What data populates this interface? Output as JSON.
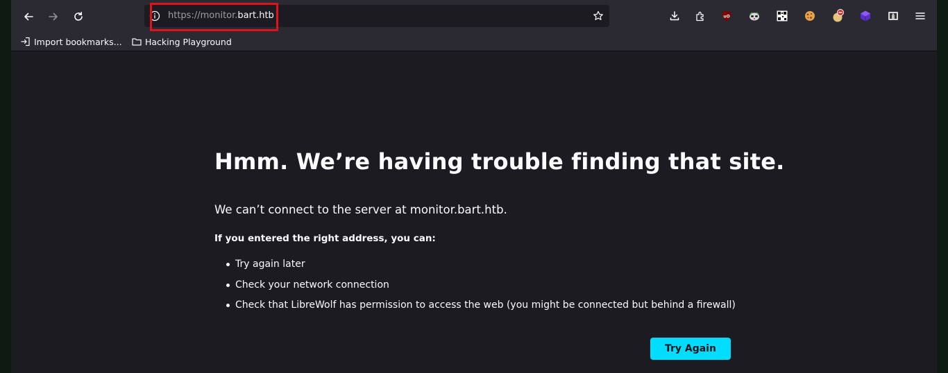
{
  "browser": {
    "url": {
      "scheme_prefix": "https://monitor.",
      "domain": "bart.htb"
    },
    "toolbar_icons": [
      "downloads-icon",
      "extensions-icon",
      "ublock-origin-icon",
      "privacy-badger-icon",
      "qr-code-icon",
      "cookie-autodelete-icon",
      "stop-sign-extension-icon",
      "cube-extension-icon",
      "picture-in-picture-icon",
      "menu-icon"
    ]
  },
  "bookmarks": {
    "import_label": "Import bookmarks...",
    "folder_label": "Hacking Playground"
  },
  "error_page": {
    "title": "Hmm. We’re having trouble finding that site.",
    "description": "We can’t connect to the server at monitor.bart.htb.",
    "subheading": "If you entered the right address, you can:",
    "suggestions": [
      "Try again later",
      "Check your network connection",
      "Check that LibreWolf has permission to access the web (you might be connected but behind a firewall)"
    ],
    "try_again_label": "Try Again"
  },
  "colors": {
    "chrome": "#2b2a33",
    "content_bg": "#1c1b22",
    "accent_button": "#00ddff",
    "highlight_box": "#e0121b"
  }
}
